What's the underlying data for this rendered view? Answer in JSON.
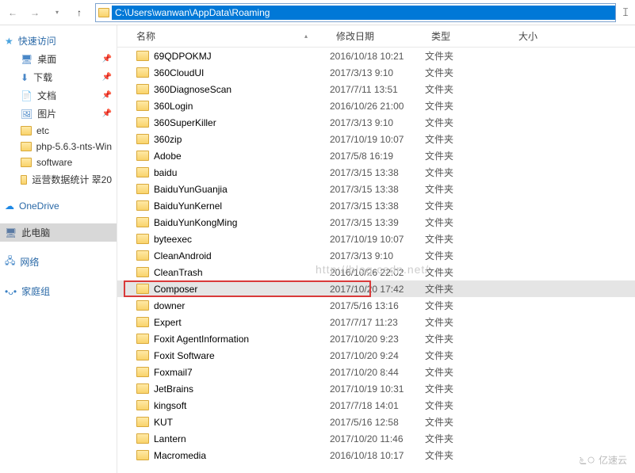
{
  "address_path": "C:\\Users\\wanwan\\AppData\\Roaming",
  "headers": {
    "name": "名称",
    "date": "修改日期",
    "type": "类型",
    "size": "大小"
  },
  "sidebar": {
    "quick_access": "快速访问",
    "items": [
      {
        "label": "桌面",
        "icon": "desktop",
        "pinned": true
      },
      {
        "label": "下载",
        "icon": "download",
        "pinned": true
      },
      {
        "label": "文档",
        "icon": "doc",
        "pinned": true
      },
      {
        "label": "图片",
        "icon": "pic",
        "pinned": true
      },
      {
        "label": "etc",
        "icon": "folder",
        "pinned": false
      },
      {
        "label": "php-5.6.3-nts-Win",
        "icon": "folder",
        "pinned": false
      },
      {
        "label": "software",
        "icon": "folder",
        "pinned": false
      },
      {
        "label": "运营数据统计 翠20",
        "icon": "folder",
        "pinned": false
      }
    ],
    "onedrive": "OneDrive",
    "this_pc": "此电脑",
    "network": "网络",
    "homegroup": "家庭组"
  },
  "files": [
    {
      "name": "69QDPOKMJ",
      "date": "2016/10/18 10:21",
      "type": "文件夹"
    },
    {
      "name": "360CloudUI",
      "date": "2017/3/13 9:10",
      "type": "文件夹"
    },
    {
      "name": "360DiagnoseScan",
      "date": "2017/7/11 13:51",
      "type": "文件夹"
    },
    {
      "name": "360Login",
      "date": "2016/10/26 21:00",
      "type": "文件夹"
    },
    {
      "name": "360SuperKiller",
      "date": "2017/3/13 9:10",
      "type": "文件夹"
    },
    {
      "name": "360zip",
      "date": "2017/10/19 10:07",
      "type": "文件夹"
    },
    {
      "name": "Adobe",
      "date": "2017/5/8 16:19",
      "type": "文件夹"
    },
    {
      "name": "baidu",
      "date": "2017/3/15 13:38",
      "type": "文件夹"
    },
    {
      "name": "BaiduYunGuanjia",
      "date": "2017/3/15 13:38",
      "type": "文件夹"
    },
    {
      "name": "BaiduYunKernel",
      "date": "2017/3/15 13:38",
      "type": "文件夹"
    },
    {
      "name": "BaiduYunKongMing",
      "date": "2017/3/15 13:39",
      "type": "文件夹"
    },
    {
      "name": "byteexec",
      "date": "2017/10/19 10:07",
      "type": "文件夹"
    },
    {
      "name": "CleanAndroid",
      "date": "2017/3/13 9:10",
      "type": "文件夹"
    },
    {
      "name": "CleanTrash",
      "date": "2016/10/26 22:02",
      "type": "文件夹"
    },
    {
      "name": "Composer",
      "date": "2017/10/20 17:42",
      "type": "文件夹",
      "selected": true,
      "highlighted": true
    },
    {
      "name": "downer",
      "date": "2017/5/16 13:16",
      "type": "文件夹"
    },
    {
      "name": "Expert",
      "date": "2017/7/17 11:23",
      "type": "文件夹"
    },
    {
      "name": "Foxit AgentInformation",
      "date": "2017/10/20 9:23",
      "type": "文件夹"
    },
    {
      "name": "Foxit Software",
      "date": "2017/10/20 9:24",
      "type": "文件夹"
    },
    {
      "name": "Foxmail7",
      "date": "2017/10/20 8:44",
      "type": "文件夹"
    },
    {
      "name": "JetBrains",
      "date": "2017/10/19 10:31",
      "type": "文件夹"
    },
    {
      "name": "kingsoft",
      "date": "2017/7/18 14:01",
      "type": "文件夹"
    },
    {
      "name": "KUT",
      "date": "2017/5/16 12:58",
      "type": "文件夹"
    },
    {
      "name": "Lantern",
      "date": "2017/10/20 11:46",
      "type": "文件夹"
    },
    {
      "name": "Macromedia",
      "date": "2016/10/18 10:17",
      "type": "文件夹"
    }
  ],
  "watermark": "http://blog.csdn.net/",
  "corner_logo": "亿速云"
}
